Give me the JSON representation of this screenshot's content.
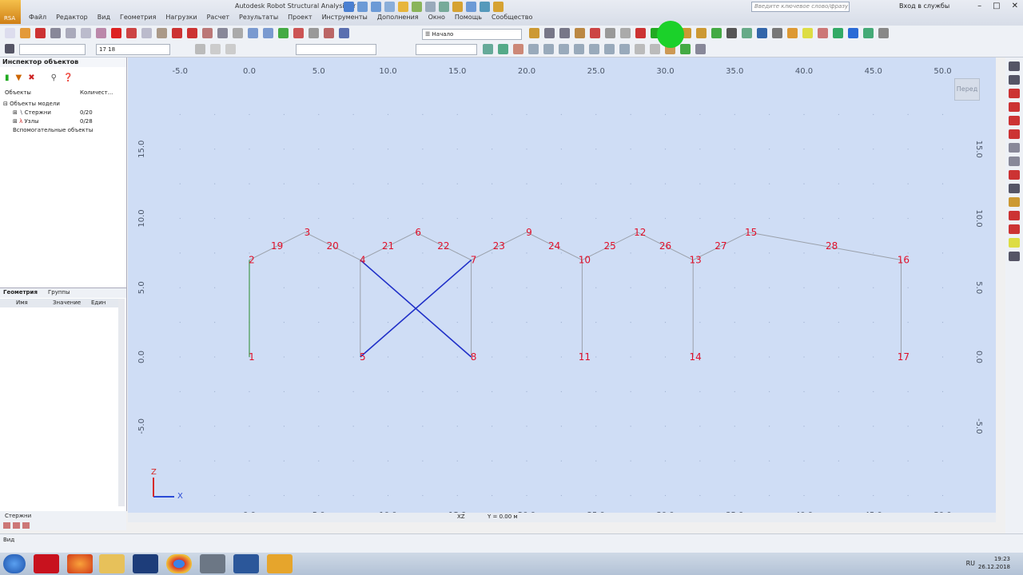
{
  "title_bar": {
    "app_label": "RSA",
    "window_title": "Autodesk Robot Structural Analysis Pr",
    "search_placeholder": "Введите ключевое слово/фразу",
    "sign_in": "Вход в службы",
    "menu": [
      "Файл",
      "Редактор",
      "Вид",
      "Геометрия",
      "Нагрузки",
      "Расчет",
      "Результаты",
      "Проект",
      "Инструменты",
      "Дополнения",
      "Окно",
      "Помощь",
      "Сообщество"
    ]
  },
  "toolbar": {
    "layout_combo": "Начало",
    "selection_value": "17 18"
  },
  "inspector": {
    "title": "Инспектор объектов",
    "col_objects": "Объекты",
    "col_count": "Количест...",
    "tree": [
      {
        "label": "Объекты модели",
        "count": ""
      },
      {
        "label": "Стержни",
        "count": "0/20"
      },
      {
        "label": "Узлы",
        "count": "0/28"
      },
      {
        "label": "Вспомогательные объекты",
        "count": ""
      }
    ],
    "tab_geometry": "Геометрия",
    "tab_groups": "Группы",
    "prop_name": "Имя",
    "prop_value": "Значение",
    "prop_unit": "Един",
    "bottom_tab": "Стержни"
  },
  "viewport": {
    "view_label": "Перед",
    "plane": "XZ",
    "coord_readout": "Y = 0.00 м",
    "axis_x_label": "X",
    "axis_z_label": "Z",
    "x_ticks": [
      "-5.0",
      "0.0",
      "5.0",
      "10.0",
      "15.0",
      "20.0",
      "25.0",
      "30.0",
      "35.0",
      "40.0",
      "45.0",
      "50.0"
    ],
    "z_ticks": [
      "15.0",
      "10.0",
      "5.0",
      "0.0",
      "-5.0"
    ],
    "nodes": [
      {
        "id": "1",
        "x": 0.0,
        "z": 0.0
      },
      {
        "id": "2",
        "x": 0.0,
        "z": 7.0
      },
      {
        "id": "3",
        "x": 4.0,
        "z": 9.0
      },
      {
        "id": "4",
        "x": 8.0,
        "z": 7.0
      },
      {
        "id": "5",
        "x": 8.0,
        "z": 0.0
      },
      {
        "id": "6",
        "x": 12.0,
        "z": 9.0
      },
      {
        "id": "7",
        "x": 16.0,
        "z": 7.0
      },
      {
        "id": "8",
        "x": 16.0,
        "z": 0.0
      },
      {
        "id": "9",
        "x": 20.0,
        "z": 9.0
      },
      {
        "id": "10",
        "x": 24.0,
        "z": 7.0
      },
      {
        "id": "11",
        "x": 24.0,
        "z": 0.0
      },
      {
        "id": "12",
        "x": 28.0,
        "z": 9.0
      },
      {
        "id": "13",
        "x": 32.0,
        "z": 7.0
      },
      {
        "id": "14",
        "x": 32.0,
        "z": 0.0
      },
      {
        "id": "15",
        "x": 36.0,
        "z": 9.0
      },
      {
        "id": "16",
        "x": 47.0,
        "z": 7.0
      },
      {
        "id": "17",
        "x": 47.0,
        "z": 0.0
      },
      {
        "id": "19",
        "x": 2.0,
        "z": 8.0
      },
      {
        "id": "20",
        "x": 6.0,
        "z": 8.0
      },
      {
        "id": "21",
        "x": 10.0,
        "z": 8.0
      },
      {
        "id": "22",
        "x": 14.0,
        "z": 8.0
      },
      {
        "id": "23",
        "x": 18.0,
        "z": 8.0
      },
      {
        "id": "24",
        "x": 22.0,
        "z": 8.0
      },
      {
        "id": "25",
        "x": 26.0,
        "z": 8.0
      },
      {
        "id": "26",
        "x": 30.0,
        "z": 8.0
      },
      {
        "id": "27",
        "x": 34.0,
        "z": 8.0
      },
      {
        "id": "28",
        "x": 42.0,
        "z": 8.0
      }
    ],
    "members": [
      {
        "from": "1",
        "to": "2",
        "style": "col"
      },
      {
        "from": "5",
        "to": "4",
        "style": "col"
      },
      {
        "from": "8",
        "to": "7",
        "style": "col"
      },
      {
        "from": "11",
        "to": "10",
        "style": "col"
      },
      {
        "from": "14",
        "to": "13",
        "style": "col"
      },
      {
        "from": "17",
        "to": "16",
        "style": "col"
      },
      {
        "from": "2",
        "to": "3",
        "style": "rafter"
      },
      {
        "from": "3",
        "to": "4",
        "style": "rafter"
      },
      {
        "from": "4",
        "to": "6",
        "style": "rafter"
      },
      {
        "from": "6",
        "to": "7",
        "style": "rafter"
      },
      {
        "from": "7",
        "to": "9",
        "style": "rafter"
      },
      {
        "from": "9",
        "to": "10",
        "style": "rafter"
      },
      {
        "from": "10",
        "to": "12",
        "style": "rafter"
      },
      {
        "from": "12",
        "to": "13",
        "style": "rafter"
      },
      {
        "from": "13",
        "to": "15",
        "style": "rafter"
      },
      {
        "from": "15",
        "to": "16",
        "style": "rafter"
      },
      {
        "from": "4",
        "to": "8",
        "style": "brace"
      },
      {
        "from": "5",
        "to": "7",
        "style": "brace"
      }
    ]
  },
  "status": {
    "mode": "Вид"
  },
  "taskbar": {
    "lang": "RU",
    "time": "19:23",
    "date": "26.12.2018"
  },
  "colors": {
    "viewport_bg": "#cfddf5",
    "node_label": "#e0102a",
    "column_line": "#9aa0aa",
    "selected_column": "#2a8a2a",
    "brace_line": "#2030c8",
    "cursor_highlight": "#1bd12a"
  }
}
